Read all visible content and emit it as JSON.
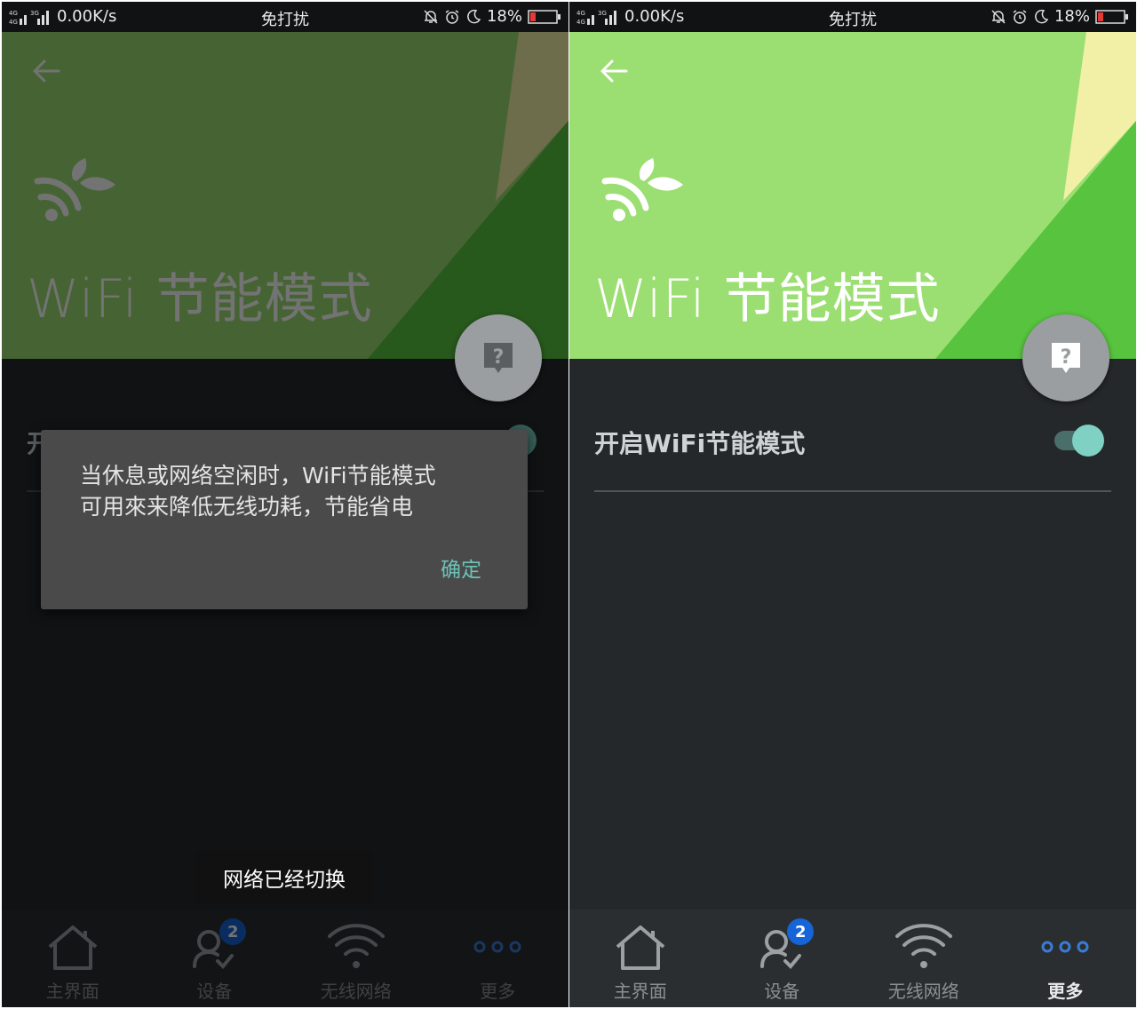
{
  "status_bar": {
    "network_speed": "0.00K/s",
    "mode": "免打扰",
    "battery": "18%",
    "signal_labels": [
      "4G",
      "4G",
      "3G"
    ]
  },
  "screen": {
    "title": "WiFi 节能模式",
    "setting_label": "开启WiFi节能模式",
    "setting_enabled": true
  },
  "dialog": {
    "message_line1": "当休息或网络空闲时，WiFi节能模式",
    "message_line2": "可用來来降低无线功耗，节能省电",
    "ok_label": "确定"
  },
  "toast": {
    "text": "网络已经切换"
  },
  "tabs": [
    {
      "label": "主界面",
      "icon": "home-icon"
    },
    {
      "label": "设备",
      "icon": "devices-icon",
      "badge": "2"
    },
    {
      "label": "无线网络",
      "icon": "wifi-icon"
    },
    {
      "label": "更多",
      "icon": "more-icon"
    }
  ],
  "active_tab_right": "更多",
  "colors": {
    "header_green": "#9bde71",
    "accent_teal": "#7ed1c3",
    "badge_blue": "#1565d8",
    "panel_bg": "#25282b"
  }
}
